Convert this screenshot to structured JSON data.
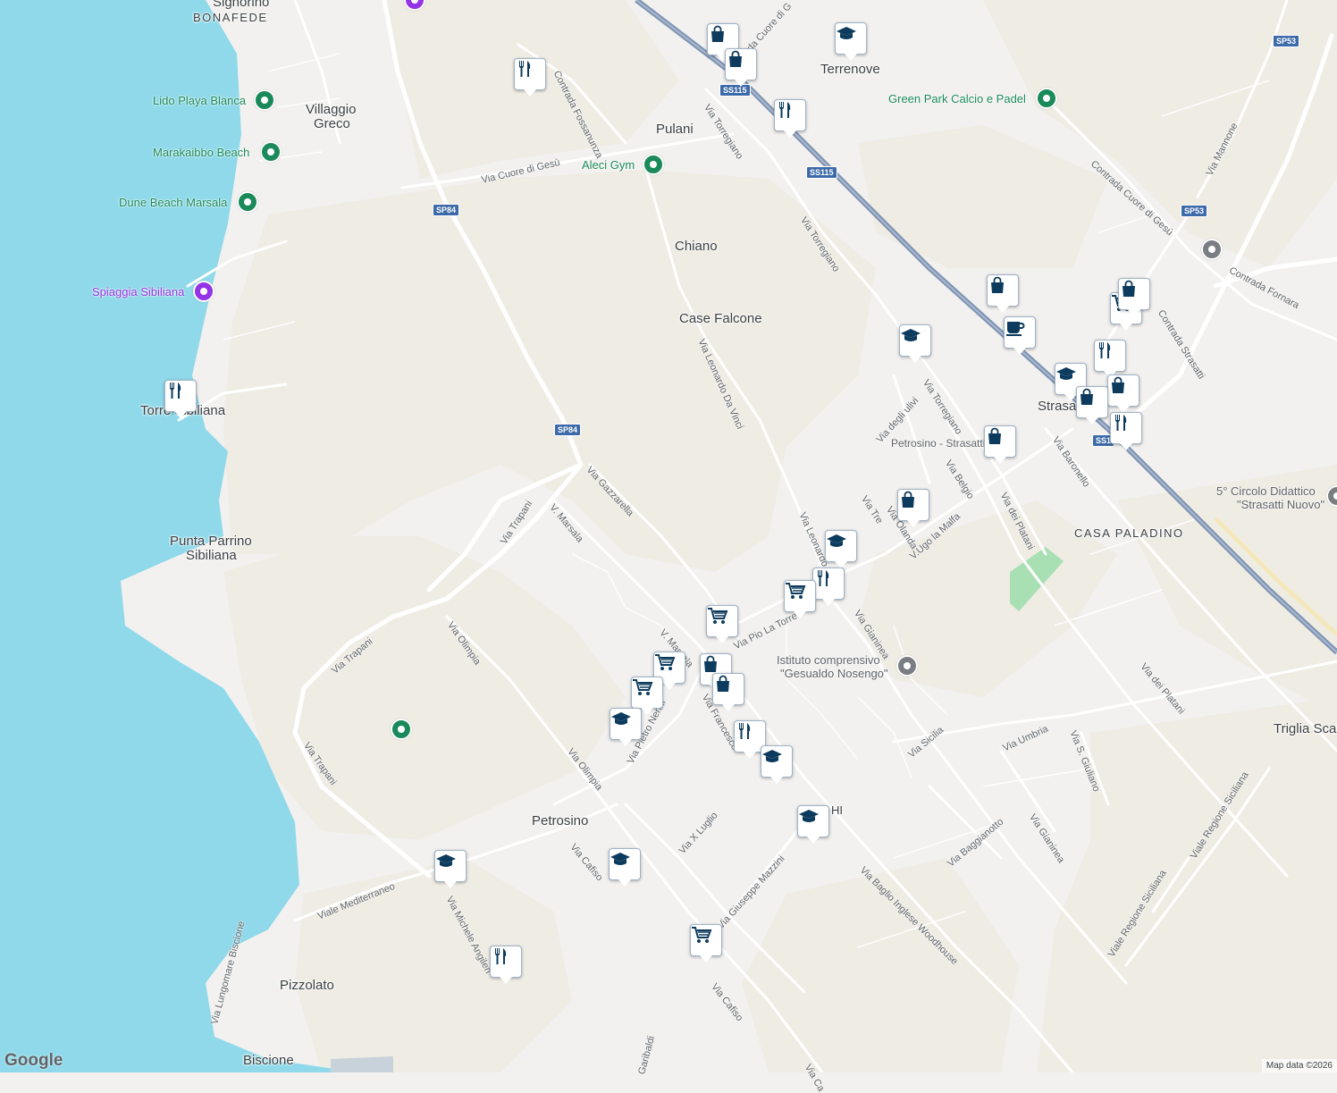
{
  "map": {
    "attribution": "Map data ©2026",
    "logo": "Google",
    "colors": {
      "sea": "#8fd9ea",
      "land": "#f2f1ef",
      "rural": "#efece4",
      "park": "#a8e0b4",
      "highway": "#7d93b3",
      "road": "#ffffff",
      "pin_icon": "#0d3b5e"
    }
  },
  "places": {
    "signorino": "Signorino",
    "bonafede": "BONAFEDE",
    "villaggio1": "Villaggio",
    "villaggio2": "Greco",
    "pulani": "Pulani",
    "terrenove": "Terrenove",
    "chiano": "Chiano",
    "case_falcone": "Case Falcone",
    "torre_sibiliana": "Torre Sibiliana",
    "punta1": "Punta Parrino",
    "punta2": "Sibiliana",
    "strasatti": "Strasatti",
    "casa_paladino": "CASA PALADINO",
    "petrosino": "Petrosino",
    "pizzolato": "Pizzolato",
    "biscione": "Biscione",
    "triglia": "Triglia Scaletta",
    "chi": "HI"
  },
  "pois": {
    "lido": "Lido Playa Blanca",
    "marakaibbo": "Marakaibbo Beach",
    "dune": "Dune Beach Marsala",
    "spiaggia": "Spiaggia Sibiliana",
    "aleci": "Aleci Gym",
    "green_park": "Green Park Calcio e Padel",
    "circolo1": "5° Circolo Didattico",
    "circolo2": "\"Strasatti Nuovo\"",
    "istituto1": "Istituto comprensivo",
    "istituto2": "\"Gesualdo Nosengo\"",
    "petrosino_strasatti": "Petrosino - Strasatti"
  },
  "roads": {
    "cuore_gesu": "Via Cuore di Gesù",
    "cuore_top": "da Cuore di G",
    "fossanunza": "Contrada Fossanunza",
    "torregiano1": "Via Torregiano",
    "torregiano2": "Via Torregiano",
    "torregiano3": "Via Torregiano",
    "contrada_cuore": "Contrada Cuore di Gesù",
    "mannone": "Via Mannone",
    "fornara": "Contrada Fornara",
    "contrada_strasatti": "Contrada Strasatti",
    "leonardo": "Via Leonardo Da Vinci",
    "leonardo2": "Via Leonardo",
    "gazzarella": "Via Gazzarella",
    "v_marsala": "V. Marsala",
    "v_marsala2": "V. Marsala",
    "trapani1": "Via Trapani",
    "trapani2": "Via Trapani",
    "trapani3": "Via Trapani",
    "olimpia1": "Via Olimpia",
    "olimpia2": "Via Olimpia",
    "ulivi": "Via degli ulivi",
    "belgio": "Via Belgio",
    "tre": "Via Tre",
    "olanda": "Via Olanda",
    "ugo": "V.Ugo la Malfa",
    "platani1": "Via dei Platani",
    "platani2": "Via dei Platani",
    "baronello": "Via Baronello",
    "pio": "Via Pio La Torre",
    "gianinea1": "Via Gianinea",
    "gianinea2": "Via Gianinea",
    "nenni": "Via Pietro Nenni",
    "francesco": "Via Francesco",
    "sicilia": "Via Sicilia",
    "umbria": "Via Umbria",
    "s_giuliano": "Via S. Giuliano",
    "baggianotto": "Via Baggianotto",
    "x_luglio": "Via X Luglio",
    "mazzini": "Via Giuseppe Mazzini",
    "baglio": "Via Baglio Inglese Woodhouse",
    "regione1": "Viale Regione Siciliana",
    "regione2": "Viale Regione Siciliana",
    "mediterraneo": "Viale Mediterraneo",
    "angileri": "Via Michele Angileri",
    "cafiso1": "Via Cafiso",
    "cafiso2": "Via Cafiso",
    "lungomare": "Via Lungomare Biscione",
    "garibaldi": "Garibaldi",
    "via_ca": "Via Ca"
  },
  "shields": {
    "ss115a": "SS115",
    "ss115b": "SS115",
    "ss115c": "SS1",
    "sp84a": "SP84",
    "sp84b": "SP84",
    "sp53a": "SP53",
    "sp53b": "SP53"
  },
  "pins": [
    {
      "type": "shopping"
    },
    {
      "type": "shopping"
    },
    {
      "type": "school"
    },
    {
      "type": "restaurant"
    },
    {
      "type": "restaurant"
    },
    {
      "type": "restaurant"
    },
    {
      "type": "shopping"
    },
    {
      "type": "cafe"
    },
    {
      "type": "school"
    },
    {
      "type": "grocery"
    },
    {
      "type": "shopping"
    },
    {
      "type": "restaurant"
    },
    {
      "type": "school"
    },
    {
      "type": "shopping"
    },
    {
      "type": "shopping"
    },
    {
      "type": "restaurant"
    },
    {
      "type": "shopping"
    },
    {
      "type": "shopping"
    },
    {
      "type": "school"
    },
    {
      "type": "restaurant"
    },
    {
      "type": "grocery"
    },
    {
      "type": "grocery"
    },
    {
      "type": "grocery"
    },
    {
      "type": "shopping"
    },
    {
      "type": "shopping"
    },
    {
      "type": "grocery"
    },
    {
      "type": "school"
    },
    {
      "type": "restaurant"
    },
    {
      "type": "school"
    },
    {
      "type": "school"
    },
    {
      "type": "school"
    },
    {
      "type": "school"
    },
    {
      "type": "grocery"
    },
    {
      "type": "restaurant"
    }
  ]
}
